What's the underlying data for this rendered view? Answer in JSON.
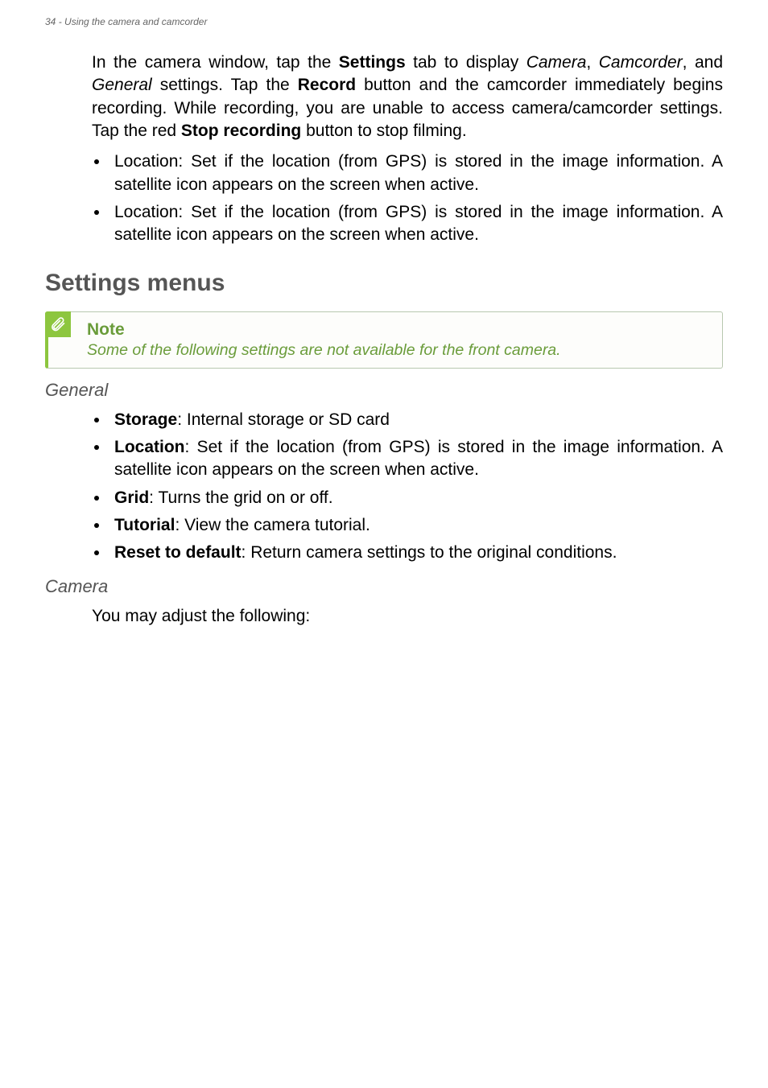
{
  "header": {
    "page_num": "34",
    "section_label": "Using the camera and camcorder"
  },
  "intro": {
    "p1_prefix": "In the camera window, tap the ",
    "p1_settings": "Settings",
    "p1_mid1": " tab to display ",
    "p1_camera": "Camera",
    "p1_comma": ", ",
    "p1_camcorder": "Camcorder",
    "p1_and": ", and ",
    "p1_general": "General",
    "p1_mid2": " settings. Tap the ",
    "p1_record": "Record",
    "p1_mid3": " button and the camcorder immediately begins recording. While recording, you are unable to access camera/camcorder settings. Tap the red ",
    "p1_stop": "Stop recording",
    "p1_end": " button to stop filming.",
    "bullets": [
      "Location: Set if the location (from GPS) is stored in the image information. A satellite icon appears on the screen when active.",
      "Location: Set if the location (from GPS) is stored in the image information. A satellite icon appears on the screen when active."
    ]
  },
  "settings_menus": {
    "title": "Settings menus",
    "note_title": "Note",
    "note_body": "Some of the following settings are not available for the front camera."
  },
  "general": {
    "heading": "General",
    "items": {
      "storage_b": "Storage",
      "storage_t": ": Internal storage or SD card",
      "location_b": "Location",
      "location_t": ": Set if the location (from GPS) is stored in the image information. A satellite icon appears on the screen when active.",
      "grid_b": "Grid",
      "grid_t": ": Turns the grid on or off.",
      "tutorial_b": "Tutorial",
      "tutorial_t": ": View the camera tutorial.",
      "reset_b": "Reset to default",
      "reset_t": ": Return camera settings to the original conditions."
    }
  },
  "camera": {
    "heading": "Camera",
    "body": "You may adjust the following:"
  }
}
